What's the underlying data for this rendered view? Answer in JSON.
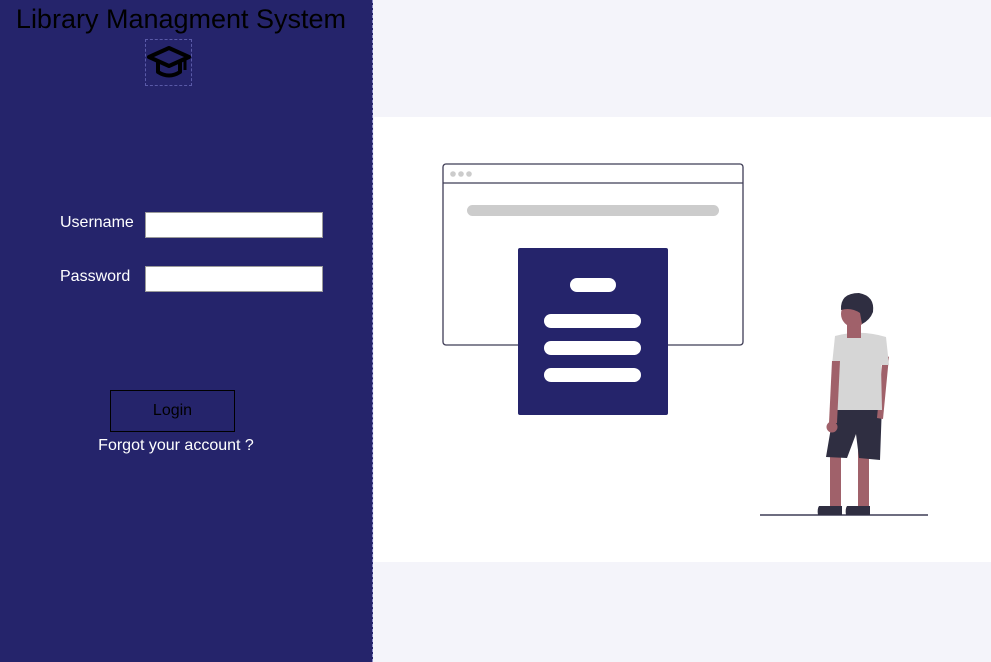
{
  "app": {
    "title": "Library Managment System",
    "logo_icon": "graduation-cap-icon"
  },
  "form": {
    "username_label": "Username",
    "username_value": "",
    "password_label": "Password",
    "password_value": "",
    "login_label": "Login",
    "forgot_label": "Forgot your account ?"
  },
  "colors": {
    "panel": "#25246b",
    "background": "#f4f4fa"
  },
  "illustration": {
    "name": "person-with-browser-illustration"
  }
}
